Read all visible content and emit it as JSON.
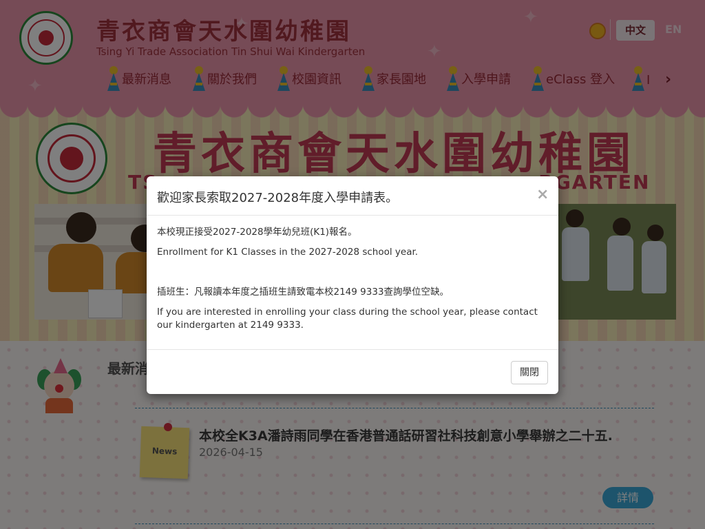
{
  "header": {
    "school_name_zh": "青衣商會天水圍幼稚園",
    "school_name_en": "Tsing Yi Trade Association Tin Shui Wai Kindergarten",
    "lang_zh": "中文",
    "lang_en": "EN",
    "nav": [
      {
        "label": "最新消息"
      },
      {
        "label": "關於我們"
      },
      {
        "label": "校園資訊"
      },
      {
        "label": "家長園地"
      },
      {
        "label": "入學申請"
      },
      {
        "label": "eClass 登入"
      },
      {
        "label": "I"
      }
    ],
    "nav_next": "›"
  },
  "banner": {
    "title_zh": "青衣商會天水圍幼稚園",
    "subtitle_partial_left": "TS",
    "subtitle_partial_right": "RGARTEN"
  },
  "news": {
    "heading": "最新消",
    "items": [
      {
        "title": "本校全K3A潘詩雨同學在香港普通話研習社科技創意小學舉辦之二十五...",
        "date": "2026-04-15",
        "tag": "News",
        "detail_label": "詳情"
      }
    ]
  },
  "modal": {
    "title": "歡迎家長索取2027-2028年度入學申請表。",
    "close_symbol": "×",
    "body": {
      "p1": "本校現正接受2027-2028學年幼兒班(K1)報名。",
      "p2": "Enrollment for K1 Classes in the 2027-2028 school year.",
      "p3": "插班生：凡報讀本年度之插班生請致電本校2149 9333查詢學位空缺。",
      "p4": "If you are interested in enrolling your class during the school year, please contact our kindergarten at 2149 9333."
    },
    "close_button": "關閉"
  },
  "colors": {
    "header_bg": "#ec97ad",
    "brand_text": "#a2333f",
    "accent_blue": "#3aa9d8"
  }
}
